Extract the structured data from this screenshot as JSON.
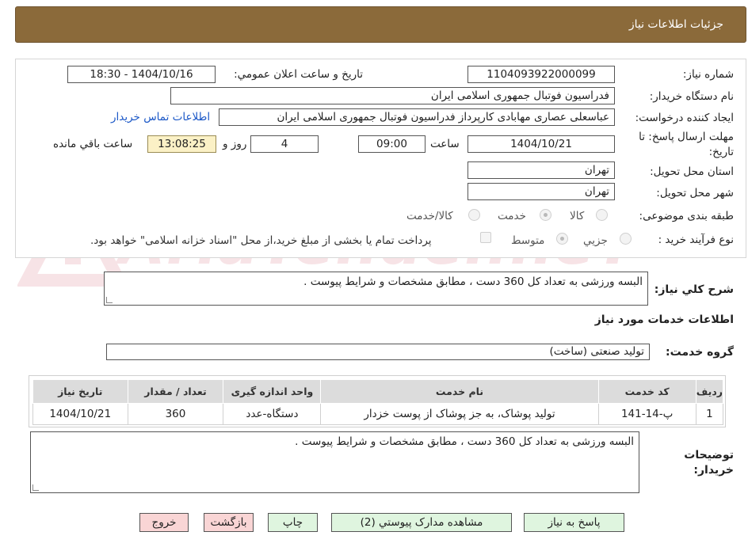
{
  "header": {
    "title": "جزئیات اطلاعات نیاز"
  },
  "form": {
    "need_number_label": "شماره نیاز:",
    "need_number": "1104093922000099",
    "announce_label": "تاریخ و ساعت اعلان عمومي:",
    "announce_value": "1404/10/16 - 18:30",
    "buyer_org_label": "نام دستگاه خریدار:",
    "buyer_org": "فدراسیون فوتبال جمهوری اسلامی ایران",
    "requester_label": "ایجاد کننده درخواست:",
    "requester": "عباسعلی عصاری مهابادی کارپرداز فدراسیون فوتبال جمهوری اسلامی ایران",
    "contact_link": "اطلاعات تماس خریدار",
    "deadline_label_1": "مهلت ارسال پاسخ: تا",
    "deadline_label_2": "تاریخ:",
    "deadline_date": "1404/10/21",
    "time_label": "ساعت",
    "deadline_time": "09:00",
    "days_value": "4",
    "days_label": "روز و",
    "remaining_time": "13:08:25",
    "remaining_label": "ساعت باقي مانده",
    "province_label": "استان محل تحویل:",
    "province": "تهران",
    "city_label": "شهر محل تحویل:",
    "city": "تهران",
    "category_label": "طبقه بندی موضوعی:",
    "category_options": [
      "کالا",
      "خدمت",
      "کالا/خدمت"
    ],
    "process_label": "نوع فرآیند خرید :",
    "process_options": [
      "جزيي",
      "متوسط"
    ],
    "payment_note": "پرداخت تمام یا بخشی از مبلغ خرید،از محل \"اسناد خزانه اسلامی\" خواهد بود."
  },
  "watermark": {
    "text": "AriaTender.neT"
  },
  "description": {
    "label": "شرح كلي نياز:",
    "text": "البسه ورزشی به تعداد کل 360 دست ، مطابق مشخصات و شرایط پیوست ."
  },
  "services": {
    "section_title": "اطلاعات خدمات مورد نیاز",
    "group_label": "گروه خدمت:",
    "group_value": "تولید صنعتی (ساخت)",
    "columns": [
      "ردیف",
      "کد خدمت",
      "نام خدمت",
      "واحد اندازه گیری",
      "تعداد / مقدار",
      "تاریخ نیاز"
    ],
    "rows": [
      [
        "1",
        "پ-14-141",
        "تولید پوشاک، به جز پوشاک از پوست خزدار",
        "دستگاه-عدد",
        "360",
        "1404/10/21"
      ]
    ]
  },
  "buyer_notes": {
    "label_1": "توضیحات",
    "label_2": "خریدار:",
    "text": "البسه ورزشی به تعداد کل 360 دست ، مطابق مشخصات و شرایط پیوست ."
  },
  "buttons": {
    "reply": "پاسخ به نیاز",
    "attachments": "مشاهده مدارک پیوستي (2)",
    "print": "چاپ",
    "back": "بازگشت",
    "exit": "خروج"
  },
  "colors": {
    "header_bg": "#8b6a3a",
    "link": "#1a57c7",
    "button_green": "#dff5df",
    "button_pink": "#f9d5d5",
    "remaining_bg": "#fbf1c6"
  }
}
